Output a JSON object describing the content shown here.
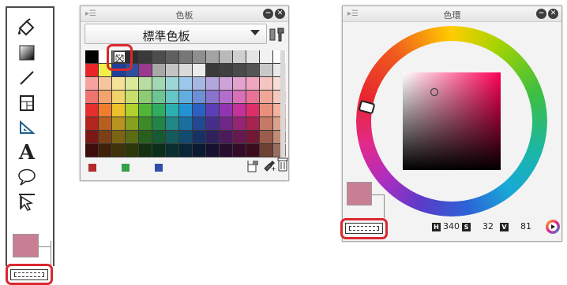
{
  "palette_panel": {
    "title": "色板",
    "set_name": "標準色板",
    "rows": [
      [
        "#000000",
        "#ffffff",
        "#6e6e6e",
        "#2e2e2e",
        "#3a3a3a",
        "#4d4d4d",
        "#5f5f5f",
        "#777777",
        "#8e8e8e",
        "#a3a3a3",
        "#b9b9b9",
        "#cfcfcf",
        "#e4e4e4",
        "#f2f2f2",
        "#ffffff"
      ],
      [
        "#e8262a",
        "#f2ef4a",
        "#1f3f9c",
        "#2f4f9f",
        "#9a3a8f",
        "#a8a8a8",
        "#c4c4c4",
        "#dadada",
        "#ececec",
        "#3a3a3a",
        "#404040",
        "#4a4a4a",
        "#555555",
        "#c9c9c9",
        "#e9e9e9"
      ],
      [
        "#f6a3a0",
        "#f7c59b",
        "#f5e29a",
        "#dbe99b",
        "#b8dda0",
        "#a3d8b5",
        "#9ed6d6",
        "#9cc9ea",
        "#a6b7e3",
        "#b3a6dd",
        "#cfa3d9",
        "#e3a3cf",
        "#f0a6bf",
        "#f4c4c0",
        "#f8dcd6"
      ],
      [
        "#ef7370",
        "#f3a36b",
        "#f1d36a",
        "#c8df6b",
        "#8dcc72",
        "#6cc593",
        "#66c5c5",
        "#62aee0",
        "#6d8fd6",
        "#8a73cf",
        "#b36ecb",
        "#d96fb8",
        "#e87396",
        "#efa79a",
        "#f5c9bb"
      ],
      [
        "#e62e2e",
        "#ef7d2a",
        "#eec12a",
        "#b0d12b",
        "#4fb638",
        "#2ead61",
        "#2bb0b0",
        "#2392d4",
        "#2c61c3",
        "#5b3fb6",
        "#9234b2",
        "#c6309a",
        "#dd2f6a",
        "#ea8f7c",
        "#f3b29e"
      ],
      [
        "#b4241f",
        "#b85f1e",
        "#b8931f",
        "#86a01f",
        "#3b8b29",
        "#218448",
        "#208686",
        "#1a6fa1",
        "#214994",
        "#452f8a",
        "#6f2788",
        "#962475",
        "#a72350",
        "#c47a67",
        "#dca18d"
      ],
      [
        "#7a1815",
        "#7d4014",
        "#7d6414",
        "#5b6c14",
        "#285f1c",
        "#165a31",
        "#155b5b",
        "#124b6d",
        "#163264",
        "#2f205e",
        "#4b1b5c",
        "#661850",
        "#721836",
        "#9b5c4c",
        "#c08a75"
      ],
      [
        "#3e0c0b",
        "#40210a",
        "#40330a",
        "#2e370a",
        "#14300e",
        "#0b2e19",
        "#0b2e2e",
        "#092638",
        "#0b1a33",
        "#181030",
        "#260e2f",
        "#340c29",
        "#3a0c1c",
        "#6e4135",
        "#9a6e5c"
      ]
    ],
    "recent_colors": [
      "#b52a2a",
      "#33a14a",
      "#2f4fa8"
    ],
    "icons": [
      "add-color-icon",
      "eyedropper-icon",
      "delete-icon"
    ]
  },
  "wheel_panel": {
    "title": "色環",
    "hue_label": "H",
    "hue_value": "340",
    "sat_label": "S",
    "sat_value": "32",
    "val_label": "V",
    "val_value": "81",
    "hue_color": "#ff0055",
    "main_color": "#c97f93",
    "sub_color": "#ffffff"
  },
  "toolbar": {
    "tools": [
      "fill-tool-icon",
      "gradient-tool-icon",
      "line-tool-icon",
      "frame-tool-icon",
      "ruler-tool-icon",
      "text-tool-icon",
      "balloon-tool-icon",
      "object-tool-icon"
    ],
    "text_tool_glyph": "A",
    "main_color": "#c97f93",
    "sub_color": "#ffffff"
  },
  "highlight_color": "#d9282e"
}
